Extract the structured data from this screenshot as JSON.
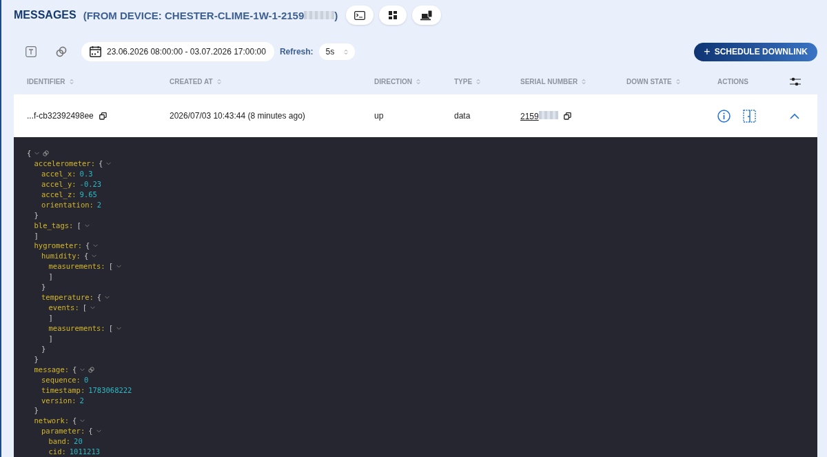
{
  "header": {
    "title": "MESSAGES",
    "subtitle": "(FROM DEVICE: CHESTER-CLIME-1W-1-2159",
    "subtitle_end": ")",
    "redacted": true
  },
  "toolbar": {
    "date_range": "23.06.2026 08:00:00 - 03.07.2026 17:00:00",
    "refresh_label": "Refresh:",
    "refresh_value": "5s",
    "schedule_button": "SCHEDULE DOWNLINK",
    "schedule_symbol": "+"
  },
  "table": {
    "columns": [
      {
        "label": "IDENTIFIER",
        "sortable": true
      },
      {
        "label": "CREATED AT",
        "sortable": true
      },
      {
        "label": "DIRECTION",
        "sortable": true
      },
      {
        "label": "TYPE",
        "sortable": true
      },
      {
        "label": "SERIAL NUMBER",
        "sortable": true
      },
      {
        "label": "DOWN STATE",
        "sortable": true
      },
      {
        "label": "ACTIONS",
        "sortable": false
      }
    ],
    "rows": [
      {
        "identifier": "...f-cb32392498ee",
        "created_at": "2026/07/03 10:43:44 (8 minutes ago)",
        "direction": "up",
        "type": "data",
        "serial_number": "2159",
        "serial_redacted": true,
        "expanded": true,
        "payload": {
          "open": "{",
          "link": true,
          "children": [
            {
              "key": "accelerometer:",
              "open": "{",
              "close": "}",
              "children": [
                {
                  "key": "accel_x:",
                  "value": "0.3"
                },
                {
                  "key": "accel_y:",
                  "value": "-0.23"
                },
                {
                  "key": "accel_z:",
                  "value": "9.65"
                },
                {
                  "key": "orientation:",
                  "value": "2"
                }
              ]
            },
            {
              "key": "ble_tags:",
              "open": "[",
              "close": "]"
            },
            {
              "key": "hygrometer:",
              "open": "{",
              "close": "}",
              "children": [
                {
                  "key": "humidity:",
                  "open": "{",
                  "close": "}",
                  "children": [
                    {
                      "key": "measurements:",
                      "open": "[",
                      "close": "]"
                    }
                  ]
                },
                {
                  "key": "temperature:",
                  "open": "{",
                  "close": "}",
                  "children": [
                    {
                      "key": "events:",
                      "open": "[",
                      "close": "]"
                    },
                    {
                      "key": "measurements:",
                      "open": "[",
                      "close": "]"
                    }
                  ]
                }
              ]
            },
            {
              "key": "message:",
              "open": "{",
              "close": "}",
              "link": true,
              "children": [
                {
                  "key": "sequence:",
                  "value": "0"
                },
                {
                  "key": "timestamp:",
                  "value": "1783068222"
                },
                {
                  "key": "version:",
                  "value": "2"
                }
              ]
            },
            {
              "key": "network:",
              "open": "{",
              "children": [
                {
                  "key": "parameter:",
                  "open": "{",
                  "children": [
                    {
                      "key": "band:",
                      "value": "20"
                    },
                    {
                      "key": "cid:",
                      "value": "1011213"
                    }
                  ]
                }
              ]
            }
          ]
        }
      }
    ]
  }
}
